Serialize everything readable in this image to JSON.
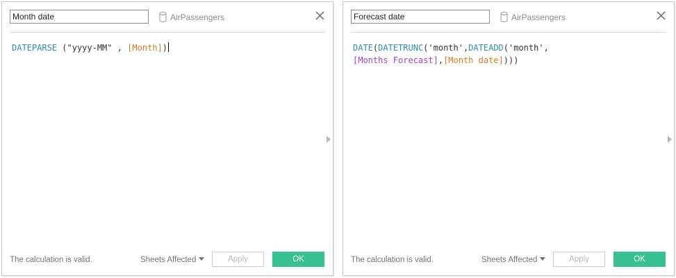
{
  "dialogs": [
    {
      "name_value": "Month date",
      "datasource": "AirPassengers",
      "formula": {
        "fn1": "DATEPARSE",
        "t1": " (",
        "str1": "\"yyyy-MM\"",
        "t2": " , ",
        "fld1": "[Month]",
        "t3": ")"
      },
      "status": "The calculation is valid.",
      "sheets_affected": "Sheets Affected",
      "apply_label": "Apply",
      "ok_label": "OK"
    },
    {
      "name_value": "Forecast date",
      "datasource": "AirPassengers",
      "formula": {
        "fn1": "DATE",
        "t1": "(",
        "fn2": "DATETRUNC",
        "t2": "('month',",
        "fn3": "DATEADD",
        "t3": "('month',",
        "param1": "[Months Forecast]",
        "t4": ",",
        "fld1": "[Month date]",
        "t5": ")))"
      },
      "status": "The calculation is valid.",
      "sheets_affected": "Sheets Affected",
      "apply_label": "Apply",
      "ok_label": "OK"
    }
  ],
  "icons": {
    "datasource": "database-cylinder-icon",
    "close": "close-x-icon",
    "expand": "triangle-right-icon"
  },
  "colors": {
    "function": "#2b8db4",
    "field": "#d9781c",
    "parameter": "#a03fc2",
    "ok_button": "#36c18e"
  }
}
